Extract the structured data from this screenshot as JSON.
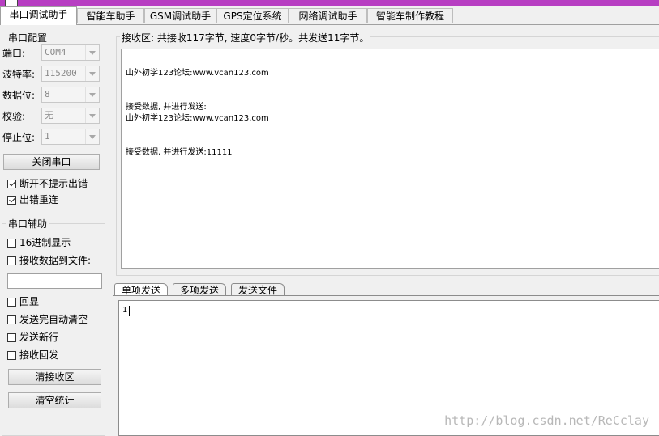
{
  "tabs": [
    "串口调试助手",
    "智能车助手",
    "GSM调试助手",
    "GPS定位系统",
    "网络调试助手",
    "智能车制作教程"
  ],
  "serial_config": {
    "title": "串口配置",
    "fields": [
      {
        "label": "端口:",
        "value": "COM4"
      },
      {
        "label": "波特率:",
        "value": "115200"
      },
      {
        "label": "数据位:",
        "value": "8"
      },
      {
        "label": "校验:",
        "value": "无"
      },
      {
        "label": "停止位:",
        "value": "1"
      }
    ],
    "close_button": "关闭串口",
    "checks": [
      {
        "label": "断开不提示出错",
        "checked": true
      },
      {
        "label": "出错重连",
        "checked": true
      }
    ]
  },
  "serial_aux": {
    "title": "串口辅助",
    "checks": [
      {
        "label": "16进制显示",
        "checked": false
      },
      {
        "label": "接收数据到文件:",
        "checked": false
      }
    ],
    "file_input": "",
    "checks2": [
      {
        "label": "回显",
        "checked": false
      },
      {
        "label": "发送完自动清空",
        "checked": false
      },
      {
        "label": "发送新行",
        "checked": false
      },
      {
        "label": "接收回发",
        "checked": false
      }
    ],
    "clear_recv_button": "清接收区",
    "clear_stats_button": "清空统计"
  },
  "receive": {
    "header": "接收区: 共接收117字节, 速度0字节/秒。共发送11字节。",
    "lines": [
      "山外初学123论坛:www.vcan123.com",
      "接受数据, 并进行发送:",
      "山外初学123论坛:www.vcan123.com",
      "接受数据, 并进行发送:11111"
    ]
  },
  "send_tabs": [
    "单项发送",
    "多项发送",
    "发送文件"
  ],
  "send": {
    "value": "1"
  },
  "watermark": "http://blog.csdn.net/ReCclay"
}
